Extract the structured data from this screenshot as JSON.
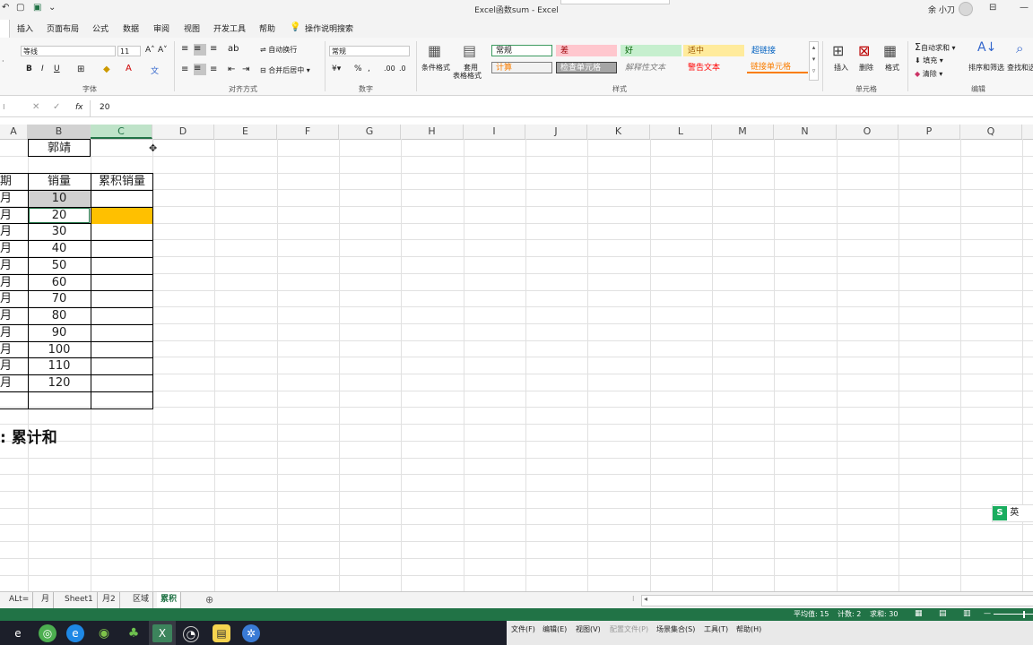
{
  "window": {
    "title": "Excel函数sum  -  Excel",
    "user": "余 小刀"
  },
  "ribbon_tabs": [
    "插入",
    "页面布局",
    "公式",
    "数据",
    "审阅",
    "视图",
    "开发工具",
    "帮助",
    "操作说明搜索"
  ],
  "ribbon": {
    "font_name": "等线",
    "font_size": "11",
    "wrap_text": "自动换行",
    "merge_center": "合并后居中",
    "number_format": "常规",
    "cond_format": "条件格式",
    "table_format_1": "套用",
    "table_format_2": "表格格式",
    "styles": [
      {
        "label": "常规",
        "bg": "#ffffff",
        "color": "#222222",
        "border": "#3c9a5f"
      },
      {
        "label": "差",
        "bg": "#ffc7ce",
        "color": "#9c0006",
        "border": "#ffc7ce"
      },
      {
        "label": "好",
        "bg": "#c6efce",
        "color": "#006100",
        "border": "#c6efce"
      },
      {
        "label": "适中",
        "bg": "#ffeb9c",
        "color": "#9c5700",
        "border": "#ffeb9c"
      },
      {
        "label": "超链接",
        "bg": "#f7f7f7",
        "color": "#0563c1",
        "border": "#f7f7f7"
      },
      {
        "label": "计算",
        "bg": "#f2f2f2",
        "color": "#fa7d00",
        "border": "#7f7f7f"
      },
      {
        "label": "检查单元格",
        "bg": "#a5a5a5",
        "color": "#ffffff",
        "border": "#3f3f3f"
      },
      {
        "label": "解释性文本",
        "bg": "#f7f7f7",
        "color": "#7f7f7f",
        "border": "#f7f7f7"
      },
      {
        "label": "警告文本",
        "bg": "#f7f7f7",
        "color": "#ff0000",
        "border": "#f7f7f7"
      },
      {
        "label": "链接单元格",
        "bg": "#f7f7f7",
        "color": "#fa7d00",
        "border": "#fa7d00"
      }
    ],
    "insert": "插入",
    "delete": "删除",
    "format": "格式",
    "autosum": "自动求和",
    "fill": "填充",
    "clear": "清除",
    "sort_filter": "排序和筛选",
    "find_select": "查找和选",
    "groups": {
      "font": "字体",
      "align": "对齐方式",
      "number": "数字",
      "styles": "样式",
      "cells": "单元格",
      "edit": "编辑"
    }
  },
  "formula_bar": {
    "value": "20",
    "fx": "fx"
  },
  "columns": [
    "A",
    "B",
    "C",
    "D",
    "E",
    "F",
    "G",
    "H",
    "I",
    "J",
    "K",
    "L",
    "M",
    "N",
    "O",
    "P",
    "Q"
  ],
  "sheet": {
    "name_cell": "郭靖",
    "headers": [
      "期",
      "销量",
      "累积销量"
    ],
    "months": [
      "月",
      "月",
      "月",
      "月",
      "月",
      "月",
      "月",
      "月",
      "月",
      "月",
      "月"
    ],
    "sales": [
      "10",
      "20",
      "30",
      "40",
      "50",
      "60",
      "70",
      "80",
      "90",
      "100",
      "110",
      "120"
    ],
    "note": ":  累计和",
    "active_fill": "#ffc000"
  },
  "sheet_tabs": [
    "ALt=",
    "月",
    "Sheet1",
    "月2",
    "区域",
    "累积"
  ],
  "status_bar": {
    "average": "平均值: 15",
    "count": "计数: 2",
    "sum": "求和: 30"
  },
  "taskbar_menu": [
    "文件(F)",
    "编辑(E)",
    "视图(V)",
    "配置文件(P)",
    "场景集合(S)",
    "工具(T)",
    "帮助(H)"
  ],
  "ime": {
    "label": "英"
  }
}
